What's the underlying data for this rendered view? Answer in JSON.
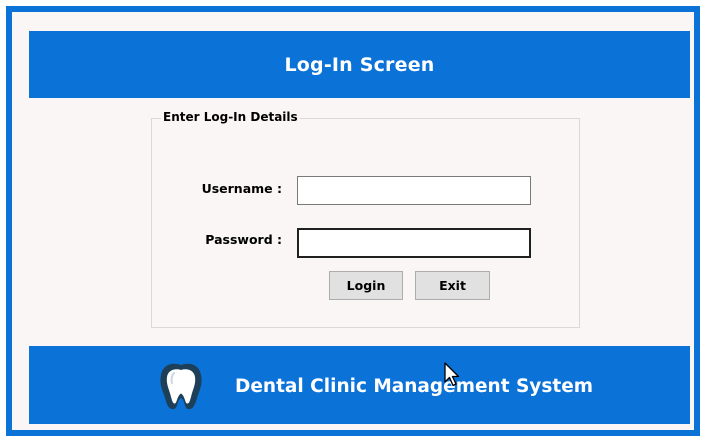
{
  "header": {
    "title": "Log-In Screen"
  },
  "login_group": {
    "legend": "Enter Log-In Details",
    "username_label": "Username :",
    "password_label": "Password :",
    "username_value": "",
    "password_value": "",
    "login_button": "Login",
    "exit_button": "Exit"
  },
  "footer": {
    "logo_icon": "tooth-icon",
    "title": "Dental Clinic Management System"
  },
  "colors": {
    "accent": "#0b72d8",
    "background": "#fbf6f6"
  }
}
